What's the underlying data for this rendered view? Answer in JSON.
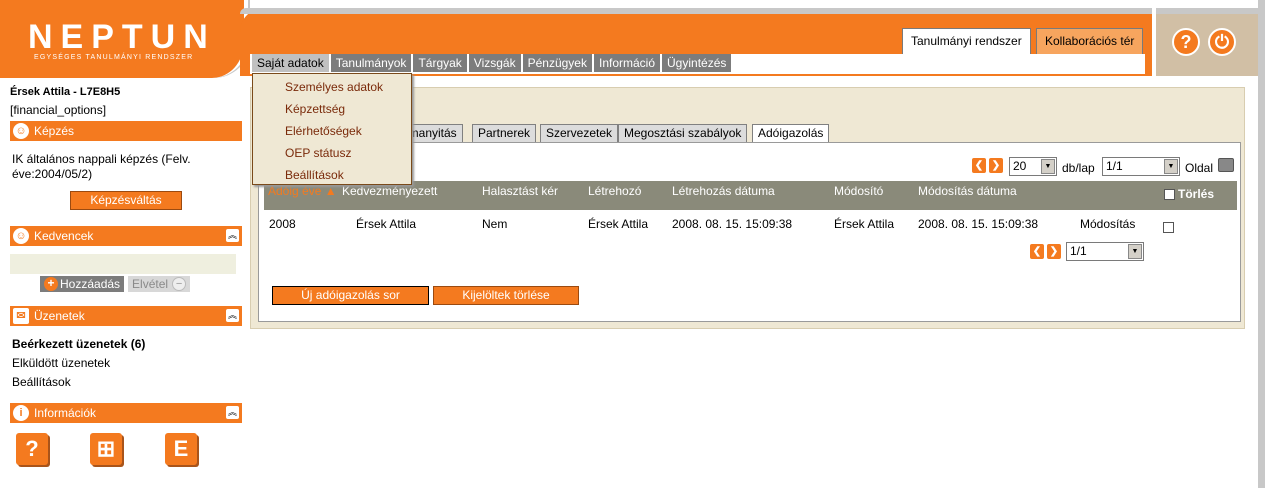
{
  "header": {
    "logo_text": "NEPTUN",
    "logo_sub": "EGYSÉGES TANULMÁNYI RENDSZER",
    "system_tabs": [
      "Tanulmányi rendszer",
      "Kollaborációs tér"
    ],
    "icons": [
      "help-icon",
      "power-icon"
    ]
  },
  "menu": [
    "Saját adatok",
    "Tanulmányok",
    "Tárgyak",
    "Vizsgák",
    "Pénzügyek",
    "Információ",
    "Ügyintézés"
  ],
  "dropdown": [
    "Személyes adatok",
    "Képzettség",
    "Elérhetőségek",
    "OEP státusz",
    "Beállítások"
  ],
  "sidebar": {
    "user": "Érsek Attila - L7E8H5",
    "financial_options": "[financial_options]",
    "kepzes_title": "Képzés",
    "kepzes_text": "IK általános nappali képzés (Felv. éve:2004/05/2)",
    "kepzesvaltas": "Képzésváltás",
    "kedvencek_title": "Kedvencek",
    "add_label": "Hozzáadás",
    "remove_label": "Elvétel",
    "uzenetek_title": "Üzenetek",
    "messages": [
      "Beérkezett üzenetek (6)",
      "Elküldött üzenetek",
      "Beállítások"
    ],
    "info_title": "Információk"
  },
  "subtabs": [
    "...lmanyitás",
    "Partnerek",
    "Szervezetek",
    "Megosztási szabályok",
    "Adóigazolás"
  ],
  "pager": {
    "per_page": "20",
    "per_page_label": "db/lap",
    "page": "1/1",
    "oldal": "Oldal"
  },
  "table": {
    "columns": [
      "Adóig éve ▲",
      "Kedvezményezett",
      "Halasztást kér",
      "Létrehozó",
      "Létrehozás dátuma",
      "Módosító",
      "Módosítás dátuma",
      "Törlés"
    ],
    "rows": [
      [
        "2008",
        "Érsek Attila",
        "Nem",
        "Érsek Attila",
        "2008. 08. 15. 15:09:38",
        "Érsek Attila",
        "2008. 08. 15. 15:09:38",
        "Módosítás"
      ]
    ]
  },
  "buttons": {
    "new_row": "Új adóigazolás sor",
    "delete_selected": "Kijelöltek törlése"
  },
  "colors": {
    "accent": "#f47a1f",
    "menu_bg": "#7c7c7c",
    "panel_bg": "#efe8d4"
  }
}
